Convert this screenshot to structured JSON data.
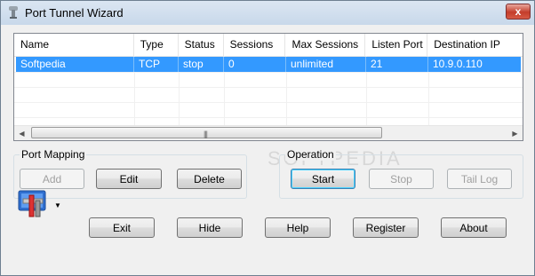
{
  "window": {
    "title": "Port Tunnel Wizard",
    "close_glyph": "x"
  },
  "table": {
    "columns": [
      "Name",
      "Type",
      "Status",
      "Sessions",
      "Max Sessions",
      "Listen Port",
      "Destination IP"
    ],
    "rows": [
      [
        "Softpedia",
        "TCP",
        "stop",
        "0",
        "unlimited",
        "21",
        "10.9.0.110"
      ]
    ],
    "selected_row": 0
  },
  "port_mapping": {
    "label": "Port Mapping",
    "add": "Add",
    "edit": "Edit",
    "delete": "Delete"
  },
  "operation": {
    "label": "Operation",
    "start": "Start",
    "stop": "Stop",
    "tail_log": "Tail Log"
  },
  "bottom_buttons": {
    "exit": "Exit",
    "hide": "Hide",
    "help": "Help",
    "register": "Register",
    "about": "About"
  },
  "watermark": "SOFTPEDIA",
  "colors": {
    "selection": "#3399ff",
    "close_button": "#c43d2b"
  }
}
